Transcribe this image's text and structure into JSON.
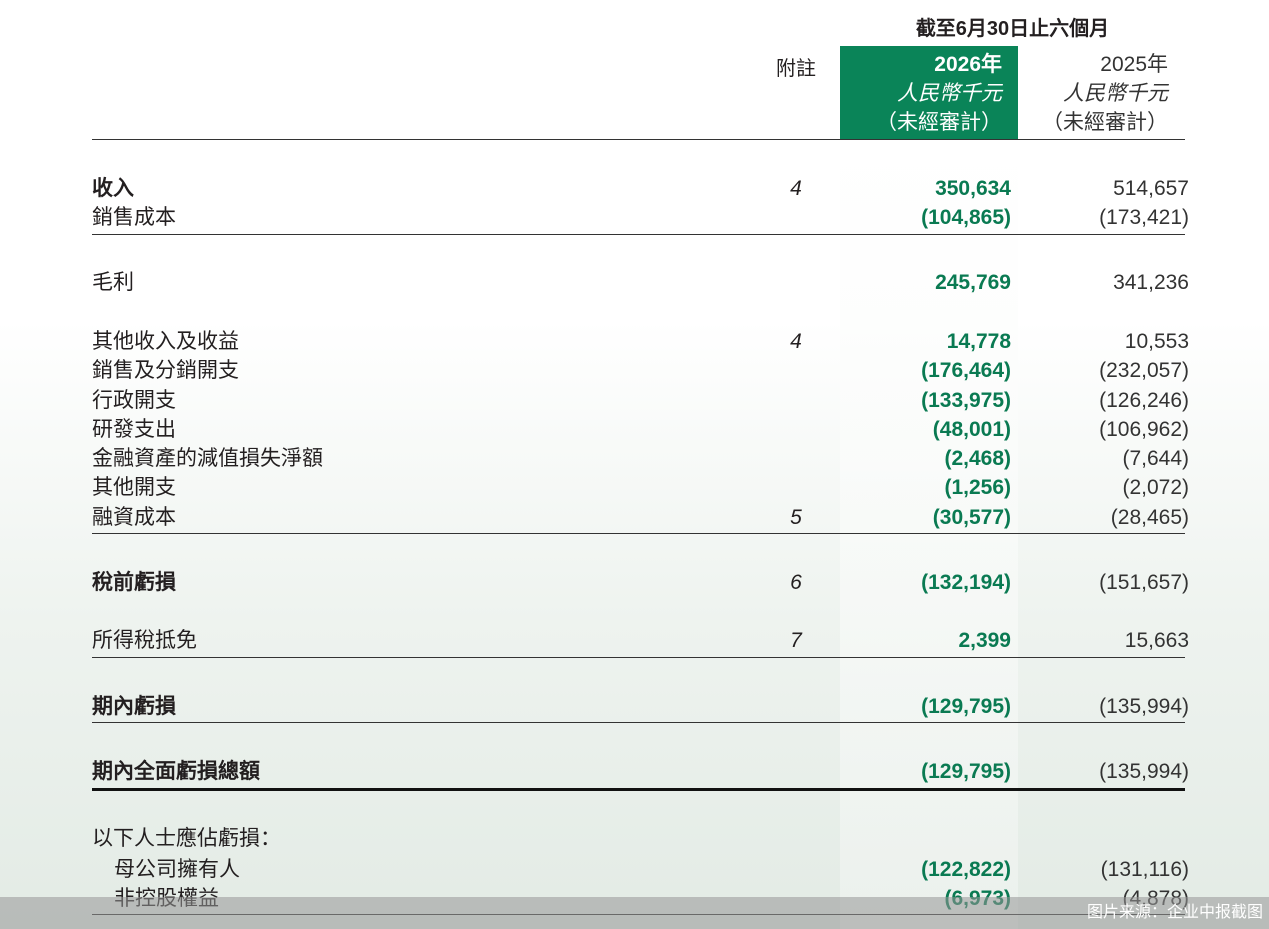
{
  "header": {
    "period_title": "截至6月30日止六個月",
    "notes_label": "附註",
    "current": {
      "year": "2026年",
      "currency": "人民幣千元",
      "audit": "（未經審計）"
    },
    "prior": {
      "year": "2025年",
      "currency": "人民幣千元",
      "audit": "（未經審計）"
    }
  },
  "rows": [
    {
      "label": "收入",
      "note": "4",
      "current": "350,634",
      "prior": "514,657"
    },
    {
      "label": "銷售成本",
      "note": "",
      "current": "(104,865)",
      "prior": "(173,421)"
    },
    {
      "label": "毛利",
      "note": "",
      "current": "245,769",
      "prior": "341,236"
    },
    {
      "label": "其他收入及收益",
      "note": "4",
      "current": "14,778",
      "prior": "10,553"
    },
    {
      "label": "銷售及分銷開支",
      "note": "",
      "current": "(176,464)",
      "prior": "(232,057)"
    },
    {
      "label": "行政開支",
      "note": "",
      "current": "(133,975)",
      "prior": "(126,246)"
    },
    {
      "label": "研發支出",
      "note": "",
      "current": "(48,001)",
      "prior": "(106,962)"
    },
    {
      "label": "金融資產的減值損失淨額",
      "note": "",
      "current": "(2,468)",
      "prior": "(7,644)"
    },
    {
      "label": "其他開支",
      "note": "",
      "current": "(1,256)",
      "prior": "(2,072)"
    },
    {
      "label": "融資成本",
      "note": "5",
      "current": "(30,577)",
      "prior": "(28,465)"
    },
    {
      "label": "稅前虧損",
      "note": "6",
      "current": "(132,194)",
      "prior": "(151,657)"
    },
    {
      "label": "所得稅抵免",
      "note": "7",
      "current": "2,399",
      "prior": "15,663"
    },
    {
      "label": "期內虧損",
      "note": "",
      "current": "(129,795)",
      "prior": "(135,994)"
    },
    {
      "label": "期內全面虧損總額",
      "note": "",
      "current": "(129,795)",
      "prior": "(135,994)"
    },
    {
      "label": "以下人士應佔虧損：",
      "note": "",
      "current": "",
      "prior": ""
    },
    {
      "label": "母公司擁有人",
      "note": "",
      "current": "(122,822)",
      "prior": "(131,116)"
    },
    {
      "label": "非控股權益",
      "note": "",
      "current": "(6,973)",
      "prior": "(4,878)"
    }
  ],
  "watermark": "图片来源：企业中报截图",
  "colors": {
    "accent_green": "#0a8458",
    "figure_green": "#0a7a52",
    "text": "#231f20"
  }
}
